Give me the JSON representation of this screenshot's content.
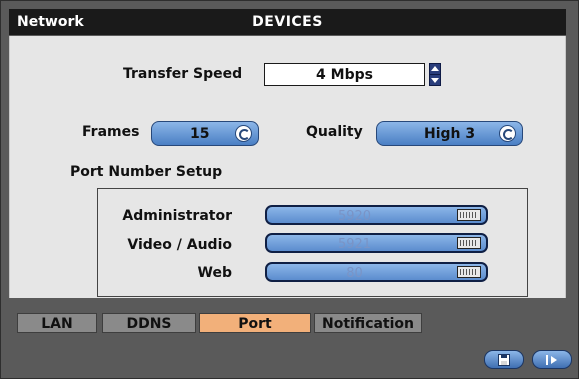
{
  "window": {
    "title_left": "Network",
    "title_center": "DEVICES"
  },
  "transfer_speed": {
    "label": "Transfer Speed",
    "value": "4 Mbps"
  },
  "frames": {
    "label": "Frames",
    "value": "15"
  },
  "quality": {
    "label": "Quality",
    "value": "High 3"
  },
  "port_setup": {
    "heading": "Port Number Setup",
    "fields": [
      {
        "label": "Administrator",
        "value": "5920"
      },
      {
        "label": "Video / Audio",
        "value": "5921"
      },
      {
        "label": "Web",
        "value": "80"
      }
    ]
  },
  "tabs": [
    {
      "label": "LAN",
      "active": false
    },
    {
      "label": "DDNS",
      "active": false
    },
    {
      "label": "Port",
      "active": true
    },
    {
      "label": "Notification",
      "active": false
    }
  ],
  "buttons": {
    "save_icon": "floppy-disk-icon",
    "exit_icon": "exit-icon"
  }
}
